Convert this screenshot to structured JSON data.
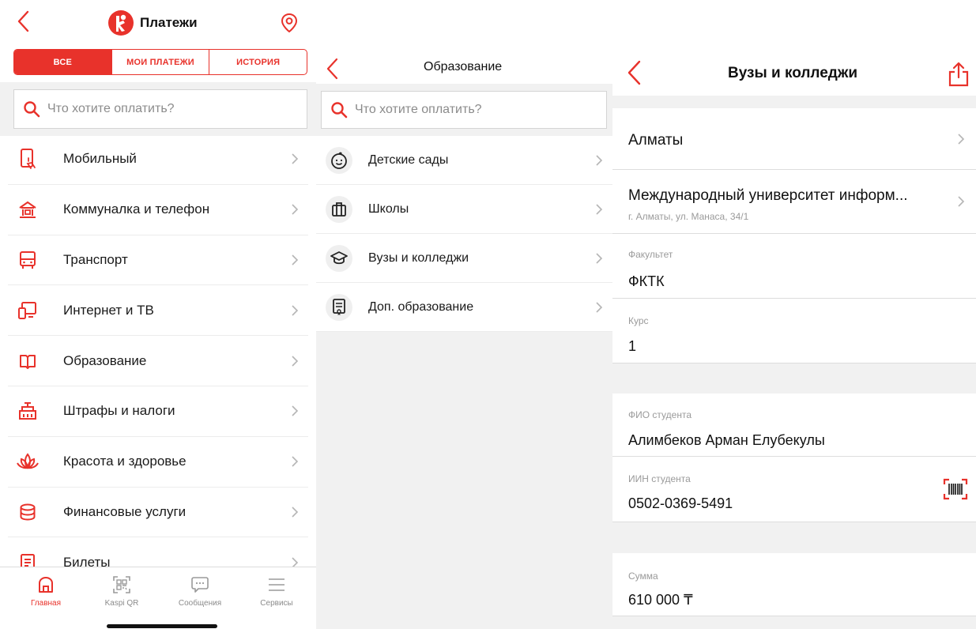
{
  "colors": {
    "accent": "#e8322b",
    "text": "#1a1a1a",
    "muted": "#8b8b8b",
    "background_gray": "#f1f1f1"
  },
  "payments": {
    "title": "Платежи",
    "back_icon": "chevron-left-icon",
    "location_icon": "location-pin-icon",
    "segments": [
      {
        "label": "ВСЕ",
        "active": true
      },
      {
        "label": "МОИ ПЛАТЕЖИ",
        "active": false
      },
      {
        "label": "ИСТОРИЯ",
        "active": false
      }
    ],
    "search_placeholder": "Что хотите оплатить?",
    "categories": [
      {
        "label": "Мобильный",
        "icon": "mobile-phone-icon"
      },
      {
        "label": "Коммуналка и телефон",
        "icon": "house-icon"
      },
      {
        "label": "Транспорт",
        "icon": "bus-icon"
      },
      {
        "label": "Интернет и ТВ",
        "icon": "tv-icon"
      },
      {
        "label": "Образование",
        "icon": "book-icon"
      },
      {
        "label": "Штрафы и налоги",
        "icon": "building-icon"
      },
      {
        "label": "Красота и здоровье",
        "icon": "lotus-icon"
      },
      {
        "label": "Финансовые услуги",
        "icon": "coins-icon"
      },
      {
        "label": "Билеты",
        "icon": "ticket-icon"
      }
    ],
    "tabbar": [
      {
        "label": "Главная",
        "icon": "home-icon",
        "active": true
      },
      {
        "label": "Kaspi QR",
        "icon": "qr-code-icon",
        "active": false
      },
      {
        "label": "Сообщения",
        "icon": "chat-icon",
        "active": false
      },
      {
        "label": "Сервисы",
        "icon": "menu-icon",
        "active": false
      }
    ]
  },
  "education": {
    "title": "Образование",
    "search_placeholder": "Что хотите оплатить?",
    "items": [
      {
        "label": "Детские сады",
        "icon": "baby-face-icon"
      },
      {
        "label": "Школы",
        "icon": "briefcase-icon"
      },
      {
        "label": "Вузы и колледжи",
        "icon": "graduation-cap-icon"
      },
      {
        "label": "Доп. образование",
        "icon": "certificate-icon"
      }
    ]
  },
  "universities": {
    "title": "Вузы и колледжи",
    "share_icon": "share-icon",
    "city": "Алматы",
    "university_name": "Международный университет информ...",
    "university_address": "г. Алматы, ул. Манаса, 34/1",
    "faculty_label": "Факультет",
    "faculty_value": "ФКТК",
    "course_label": "Курс",
    "course_value": "1",
    "student_name_label": "ФИО студента",
    "student_name_value": "Алимбеков Арман Елубекулы",
    "student_iin_label": "ИИН студента",
    "student_iin_value": "0502-0369-5491",
    "barcode_icon": "barcode-scanner-icon",
    "amount_label": "Сумма",
    "amount_value": "610 000 ₸"
  }
}
